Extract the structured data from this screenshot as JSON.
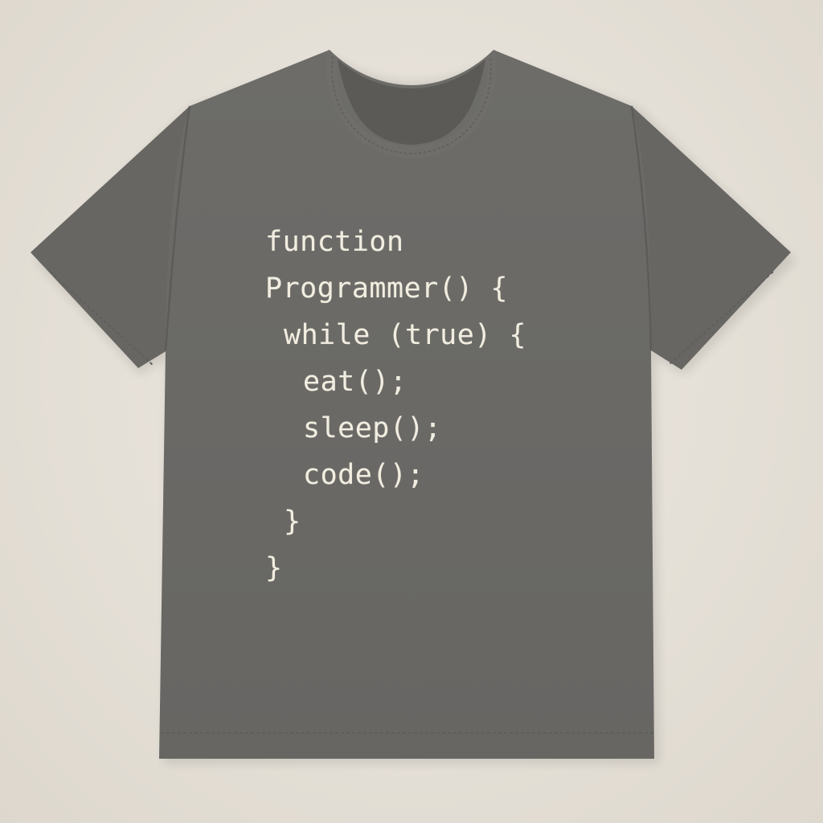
{
  "colors": {
    "background": "#e6e1d9",
    "shirt": "#6b6a67",
    "shirt_shadow": "#5d5c59",
    "print_text": "#f1ede0"
  },
  "shirt": {
    "print": {
      "lines": [
        "function",
        "Programmer() {",
        "while (true) {",
        "eat();",
        "sleep();",
        "code();",
        "}",
        "}"
      ]
    }
  }
}
